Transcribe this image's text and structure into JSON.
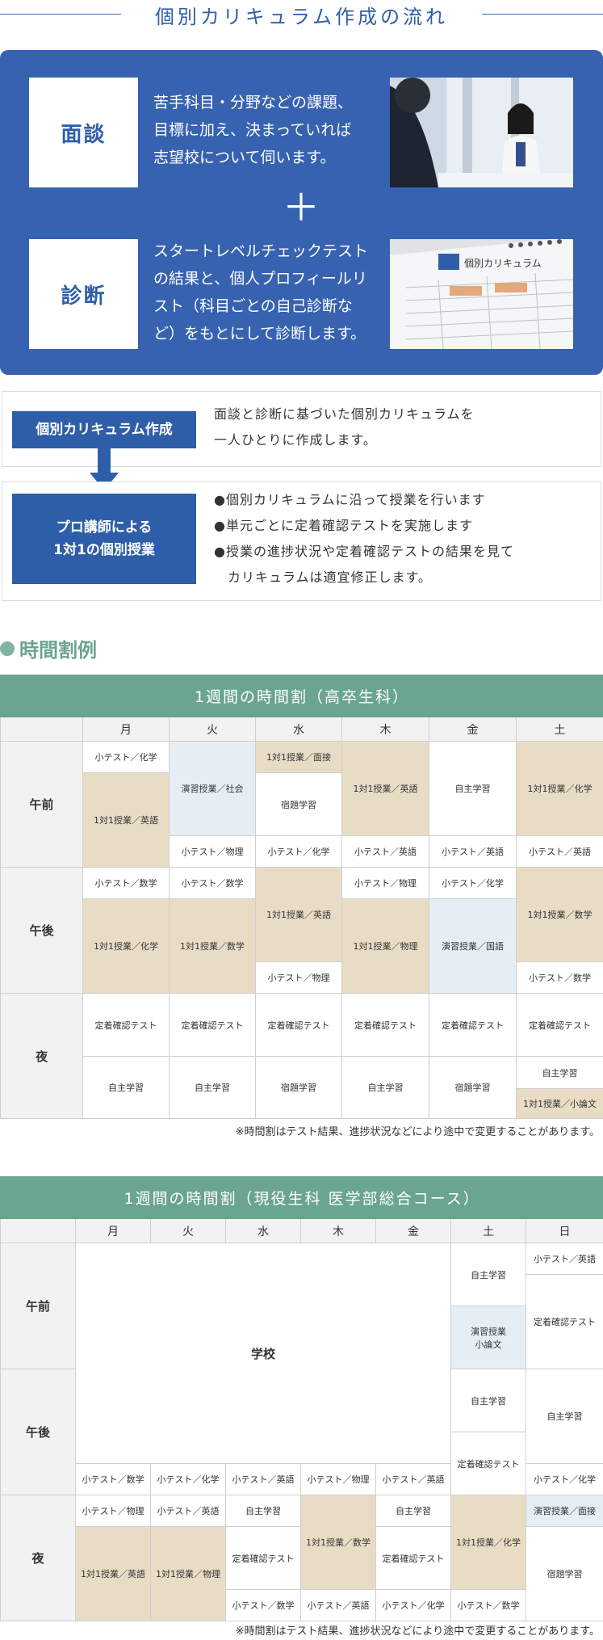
{
  "header": {
    "title": "個別カリキュラム作成の流れ"
  },
  "intro": {
    "interview": {
      "label": "面談",
      "text_lines": [
        "苦手科目・分野などの課題、",
        "目標に加え、決まっていれば",
        "志望校について伺います。"
      ]
    },
    "plus": "＋",
    "diagnosis": {
      "label": "診断",
      "text_lines": [
        "スタートレベルチェックテスト",
        "の結果と、個人プロフィールリ",
        "スト（科目ごとの自己診断な",
        "ど）をもとにして診断します。"
      ]
    },
    "photo_doc_label": "個別カリキュラム"
  },
  "flow": {
    "step1": {
      "label": "個別カリキュラム作成",
      "text_lines": [
        "面談と診断に基づいた個別カリキュラムを",
        "一人ひとりに作成します。"
      ]
    },
    "step2": {
      "label_lines": [
        "プロ講師による",
        "1対1の個別授業"
      ],
      "bullets": [
        "●個別カリキュラムに沿って授業を行います",
        "●単元ごとに定着確認テストを実施します",
        "●授業の進捗状況や定着確認テストの結果を見て",
        "　カリキュラムは適宜修正します。"
      ]
    }
  },
  "section": {
    "title": "時間割例"
  },
  "table1": {
    "caption": "1週間の時間割（高卒生科）",
    "days": [
      "月",
      "火",
      "水",
      "木",
      "金",
      "土"
    ],
    "periods": [
      "午前",
      "午後",
      "夜"
    ],
    "cells": {
      "am_mon_a": "小テスト／化学",
      "am_mon_b": "1対1授業／英語",
      "am_tue_a": "演習授業／社会",
      "am_tue_b": "小テスト／物理",
      "am_wed_a": "1対1授業／面接",
      "am_wed_b": "宿題学習",
      "am_wed_c": "小テスト／化学",
      "am_thu_a": "1対1授業／英語",
      "am_thu_b": "小テスト／英語",
      "am_fri_a": "自主学習",
      "am_fri_b": "小テスト／英語",
      "am_sat_a": "1対1授業／化学",
      "am_sat_b": "小テスト／英語",
      "pm_mon_a": "小テスト／数学",
      "pm_mon_b": "1対1授業／化学",
      "pm_tue_a": "小テスト／数学",
      "pm_tue_b": "1対1授業／数学",
      "pm_wed_a": "1対1授業／英語",
      "pm_wed_b": "小テスト／物理",
      "pm_thu_a": "小テスト／物理",
      "pm_thu_b": "1対1授業／物理",
      "pm_fri_a": "小テスト／化学",
      "pm_fri_b": "演習授業／国語",
      "pm_sat_a": "1対1授業／数学",
      "pm_sat_b": "小テスト／数学",
      "ev_mon_a": "定着確認テスト",
      "ev_mon_b": "自主学習",
      "ev_tue_a": "定着確認テスト",
      "ev_tue_b": "自主学習",
      "ev_wed_a": "定着確認テスト",
      "ev_wed_b": "宿題学習",
      "ev_thu_a": "定着確認テスト",
      "ev_thu_b": "自主学習",
      "ev_fri_a": "定着確認テスト",
      "ev_fri_b": "宿題学習",
      "ev_sat_a": "定着確認テスト",
      "ev_sat_b": "自主学習",
      "ev_sat_c": "1対1授業／小論文"
    },
    "note": "※時間割はテスト結果、進捗状況などにより途中で変更することがあります。"
  },
  "table2": {
    "caption": "1週間の時間割（現役生科 医学部総合コース）",
    "days": [
      "月",
      "火",
      "水",
      "木",
      "金",
      "土",
      "日"
    ],
    "periods": [
      "午前",
      "午後",
      "夜"
    ],
    "cells": {
      "school": "学校",
      "sat_am_a": "自主学習",
      "sat_am_b": "演習授業\n小論文",
      "sat_pm_a": "自主学習",
      "sat_pm_b": "定着確認テスト",
      "sun_am_a": "小テスト／英語",
      "sun_am_b": "定着確認テスト",
      "sun_pm_a": "自主学習",
      "sun_pm_b": "小テスト／化学",
      "pm_mon": "小テスト／数学",
      "pm_tue": "小テスト／化学",
      "pm_wed": "小テスト／英語",
      "pm_thu": "小テスト／物理",
      "pm_fri": "小テスト／英語",
      "ev_mon_a": "小テスト／物理",
      "ev_mon_b": "1対1授業／英語",
      "ev_tue_a": "小テスト／英語",
      "ev_tue_b": "1対1授業／物理",
      "ev_wed_a": "自主学習",
      "ev_wed_b": "定着確認テスト",
      "ev_wed_c": "小テスト／数学",
      "ev_thu_a": "1対1授業／数学",
      "ev_thu_b": "小テスト／英語",
      "ev_fri_a": "自主学習",
      "ev_fri_b": "定着確認テスト",
      "ev_fri_c": "小テスト／化学",
      "ev_sat_a": "1対1授業／化学",
      "ev_sat_b": "小テスト／数学",
      "ev_sun_a": "演習授業／面接",
      "ev_sun_b": "宿題学習"
    },
    "note": "※時間割はテスト結果、進捗状況などにより途中で変更することがあります。"
  },
  "colors": {
    "blue": "#3762b0",
    "green": "#6aa58d",
    "beige": "#e9dcc5",
    "light_blue": "#e6eef5"
  }
}
